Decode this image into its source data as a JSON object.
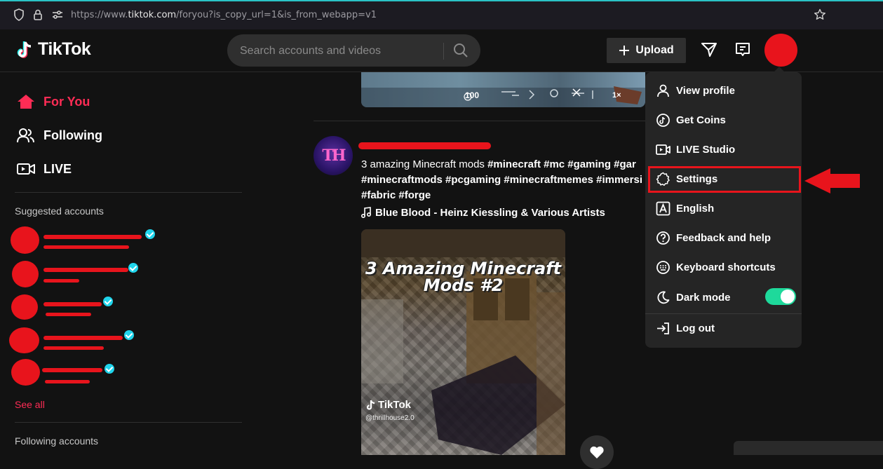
{
  "browser": {
    "url_scheme": "https://www.",
    "url_host": "tiktok.com",
    "url_rest": "/foryou?is_copy_url=1&is_from_webapp=v1"
  },
  "header": {
    "logo_text": "TikTok",
    "search_placeholder": "Search accounts and videos",
    "upload_label": "Upload"
  },
  "sidebar": {
    "nav": [
      {
        "label": "For You",
        "icon": "home-icon",
        "active": true
      },
      {
        "label": "Following",
        "icon": "following-icon",
        "active": false
      },
      {
        "label": "LIVE",
        "icon": "live-icon",
        "active": false
      }
    ],
    "suggested_title": "Suggested accounts",
    "see_all": "See all",
    "following_title": "Following accounts"
  },
  "post": {
    "avatar_initials": "TH",
    "caption_line1": "3 amazing Minecraft mods ",
    "caption_tags1": "#minecraft #mc #gaming #gar",
    "caption_tags2": "#minecraftmods #pcgaming #minecraftmemes #immersi",
    "caption_tags3": "#fabric #forge",
    "music": "Blue Blood - Heinz Kiessling & Various Artists",
    "video_title": "3 Amazing Minecraft Mods #2",
    "watermark": "TikTok",
    "watermark_user": "@thrillhouse2.0",
    "prev_hud_count": "100",
    "prev_hud_right": "1×"
  },
  "dropdown": {
    "items": [
      {
        "label": "View profile",
        "icon": "user-icon"
      },
      {
        "label": "Get Coins",
        "icon": "coin-icon"
      },
      {
        "label": "LIVE Studio",
        "icon": "live-studio-icon"
      },
      {
        "label": "Settings",
        "icon": "gear-icon"
      },
      {
        "label": "English",
        "icon": "language-icon"
      },
      {
        "label": "Feedback and help",
        "icon": "help-icon"
      },
      {
        "label": "Keyboard shortcuts",
        "icon": "keyboard-icon"
      },
      {
        "label": "Dark mode",
        "icon": "moon-icon"
      },
      {
        "label": "Log out",
        "icon": "logout-icon"
      }
    ],
    "dark_mode_on": true
  },
  "colors": {
    "accent": "#fe2c55",
    "annotation_red": "#e8141c",
    "verified": "#20d5ec",
    "toggle_on": "#1ed99b"
  }
}
